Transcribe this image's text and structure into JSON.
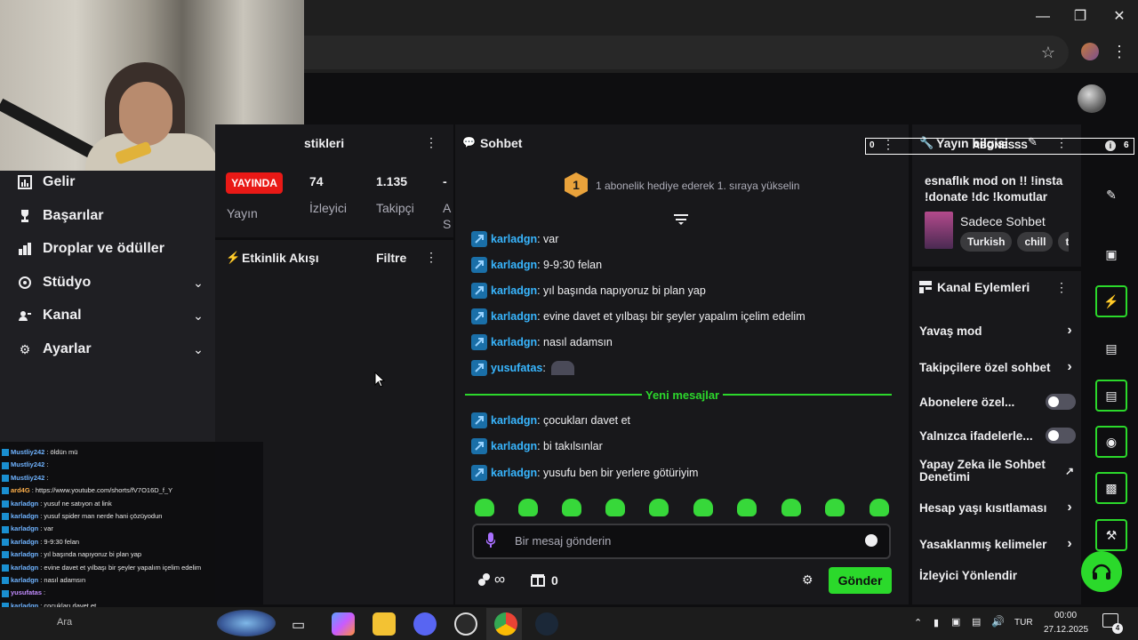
{
  "sidebar": {
    "items": [
      {
        "label": "Gelir",
        "icon": "income-icon",
        "has_chevron": false
      },
      {
        "label": "Başarılar",
        "icon": "trophy-icon",
        "has_chevron": false
      },
      {
        "label": "Droplar ve ödüller",
        "icon": "drops-icon",
        "has_chevron": false
      },
      {
        "label": "Stüdyo",
        "icon": "studio-icon",
        "has_chevron": true
      },
      {
        "label": "Kanal",
        "icon": "channel-icon",
        "has_chevron": true
      },
      {
        "label": "Ayarlar",
        "icon": "gear-icon",
        "has_chevron": true
      }
    ]
  },
  "stats": {
    "title": "stikleri",
    "live_badge": "YAYINDA",
    "live_label": "Yayın",
    "viewers_value": "74",
    "viewers_label": "İzleyici",
    "followers_value": "1.135",
    "followers_label": "Takipçi",
    "extra_value": "-",
    "extra_label_1": "A",
    "extra_label_2": "S"
  },
  "activity": {
    "title": "Etkinlik Akışı",
    "filter_label": "Filtre"
  },
  "chat": {
    "title": "Sohbet",
    "hype_level": "1",
    "hype_text": "1 abonelik hediye ederek 1. sıraya yükselin",
    "messages_before": [
      {
        "user": "karladgn",
        "text": ": var"
      },
      {
        "user": "karladgn",
        "text": ": 9-9:30 felan"
      },
      {
        "user": "karladgn",
        "text": ": yıl başında napıyoruz bi plan yap"
      },
      {
        "user": "karladgn",
        "text": ": evine davet et yılbaşı bir şeyler yapalım içelim edelim"
      },
      {
        "user": "karladgn",
        "text": ": nasıl adamsın"
      },
      {
        "user": "yusufatas",
        "text": ":"
      }
    ],
    "new_messages_label": "Yeni mesajlar",
    "messages_after": [
      {
        "user": "karladgn",
        "text": ": çocukları davet et"
      },
      {
        "user": "karladgn",
        "text": ": bi takılsınlar"
      },
      {
        "user": "karladgn",
        "text": ": yusufu ben bir yerlere götüriyim"
      }
    ],
    "input_placeholder": "Bir mesaj gönderin",
    "points_symbol": "∞",
    "bits_count": "0",
    "send_label": "Gönder"
  },
  "stream_info": {
    "title": "Yayın bilgisi",
    "stream_title": "esnaflık mod on !! !insta !donate !dc !komutlar",
    "category": "Sadece Sohbet",
    "tags": [
      "Turkish",
      "chill",
      "tu"
    ]
  },
  "overlay_box": {
    "left_num": "0",
    "center_text": "ABONESSS",
    "right_num": "6"
  },
  "actions": {
    "title": "Kanal Eylemleri",
    "rows": [
      {
        "label": "Yavaş mod",
        "control": "chevron"
      },
      {
        "label": "Takipçilere özel sohbet",
        "control": "chevron"
      },
      {
        "label": "Abonelere özel...",
        "control": "toggle"
      },
      {
        "label": "Yalnızca ifadelerle...",
        "control": "toggle"
      },
      {
        "label": "Yapay Zeka ile Sohbet Denetimi",
        "control": "external"
      },
      {
        "label": "Hesap yaşı kısıtlaması",
        "control": "chevron"
      },
      {
        "label": "Yasaklanmış kelimeler",
        "control": "chevron"
      },
      {
        "label": "İzleyici Yönlendir",
        "control": "none"
      }
    ]
  },
  "overlay_chat": [
    {
      "user": "Mustliy242",
      "text": ": öldün mü",
      "color": "blue"
    },
    {
      "user": "Mustliy242",
      "text": ":",
      "color": "blue"
    },
    {
      "user": "Mustliy242",
      "text": ":",
      "color": "blue"
    },
    {
      "user": "ard4G",
      "text": ": https://www.youtube.com/shorts/fV7O16D_f_Y",
      "color": "orange"
    },
    {
      "user": "karladgn",
      "text": ": yusuf ne satıyon at link",
      "color": "blue"
    },
    {
      "user": "karladgn",
      "text": ": yusuf spider man nerde hani çözüyodun",
      "color": "blue"
    },
    {
      "user": "karladgn",
      "text": ": var",
      "color": "blue"
    },
    {
      "user": "karladgn",
      "text": ": 9-9:30 felan",
      "color": "blue"
    },
    {
      "user": "karladgn",
      "text": ": yıl başında napıyoruz bi plan yap",
      "color": "blue"
    },
    {
      "user": "karladgn",
      "text": ": evine davet et yılbaşı bir şeyler yapalım içelim edelim",
      "color": "blue"
    },
    {
      "user": "karladgn",
      "text": ": nasıl adamsın",
      "color": "blue"
    },
    {
      "user": "yusufatas",
      "text": ":",
      "color": "purple"
    },
    {
      "user": "karladgn",
      "text": ": çocukları davet et",
      "color": "blue"
    },
    {
      "user": "karladgn",
      "text": ": bi takılsınlar",
      "color": "blue"
    },
    {
      "user": "karladgn",
      "text": ": yusufu ben bir yerlere götüriyim",
      "color": "blue"
    }
  ],
  "taskbar": {
    "search_text": "Ara",
    "language": "TUR",
    "time": "00:00",
    "date": "27.12.2025",
    "notification_count": "4"
  },
  "colors": {
    "accent_green": "#2bd92b",
    "live_red": "#e91916",
    "chat_name_blue": "#38b6ff",
    "panel_bg": "#18181b"
  }
}
